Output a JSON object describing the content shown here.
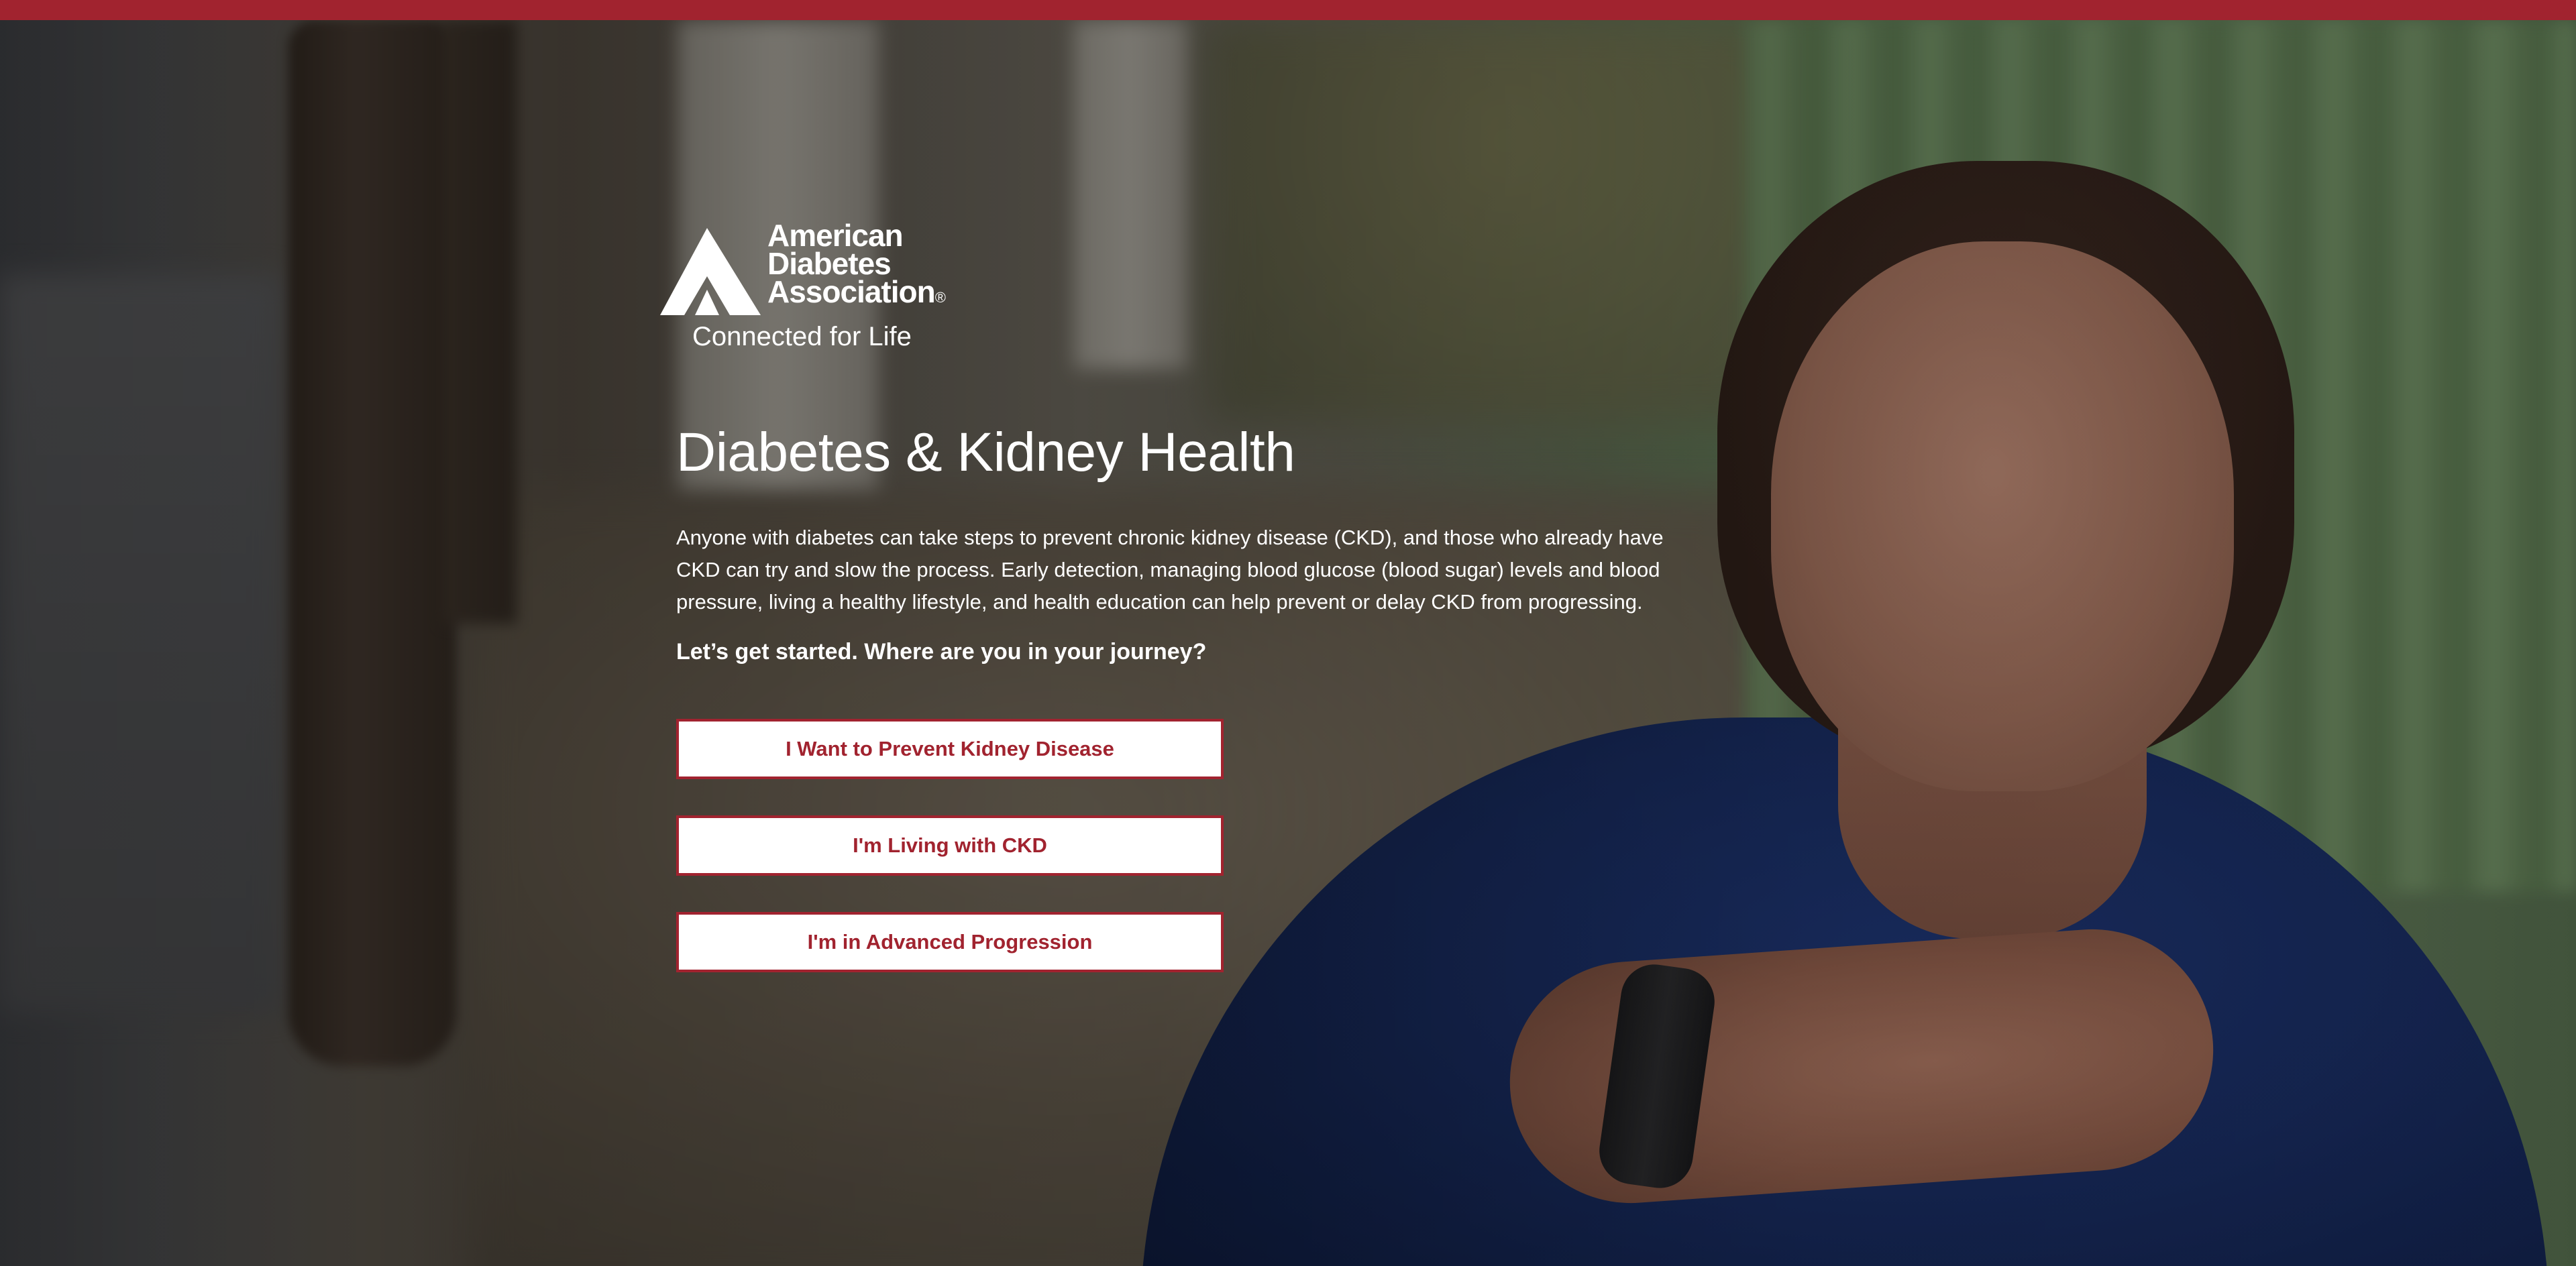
{
  "theme": {
    "accent": "#a1232f",
    "text_on_hero": "#ffffff",
    "button_bg": "#ffffff"
  },
  "logo": {
    "line1": "American",
    "line2": "Diabetes",
    "line3": "Association",
    "tagline": "Connected for Life",
    "icon": "ada-triangle-logo-icon"
  },
  "hero": {
    "title": "Diabetes & Kidney Health",
    "intro": "Anyone with diabetes can take steps to prevent chronic kidney disease (CKD), and those who already have CKD can try and slow the process. Early detection, managing blood glucose (blood sugar) levels and blood pressure, living a healthy lifestyle, and health education can help prevent or delay CKD from progressing.",
    "prompt": "Let’s get started. Where are you in your journey?"
  },
  "choices": [
    {
      "label": "I Want to Prevent Kidney Disease"
    },
    {
      "label": "I'm Living with CKD"
    },
    {
      "label": "I'm in Advanced Progression"
    }
  ]
}
